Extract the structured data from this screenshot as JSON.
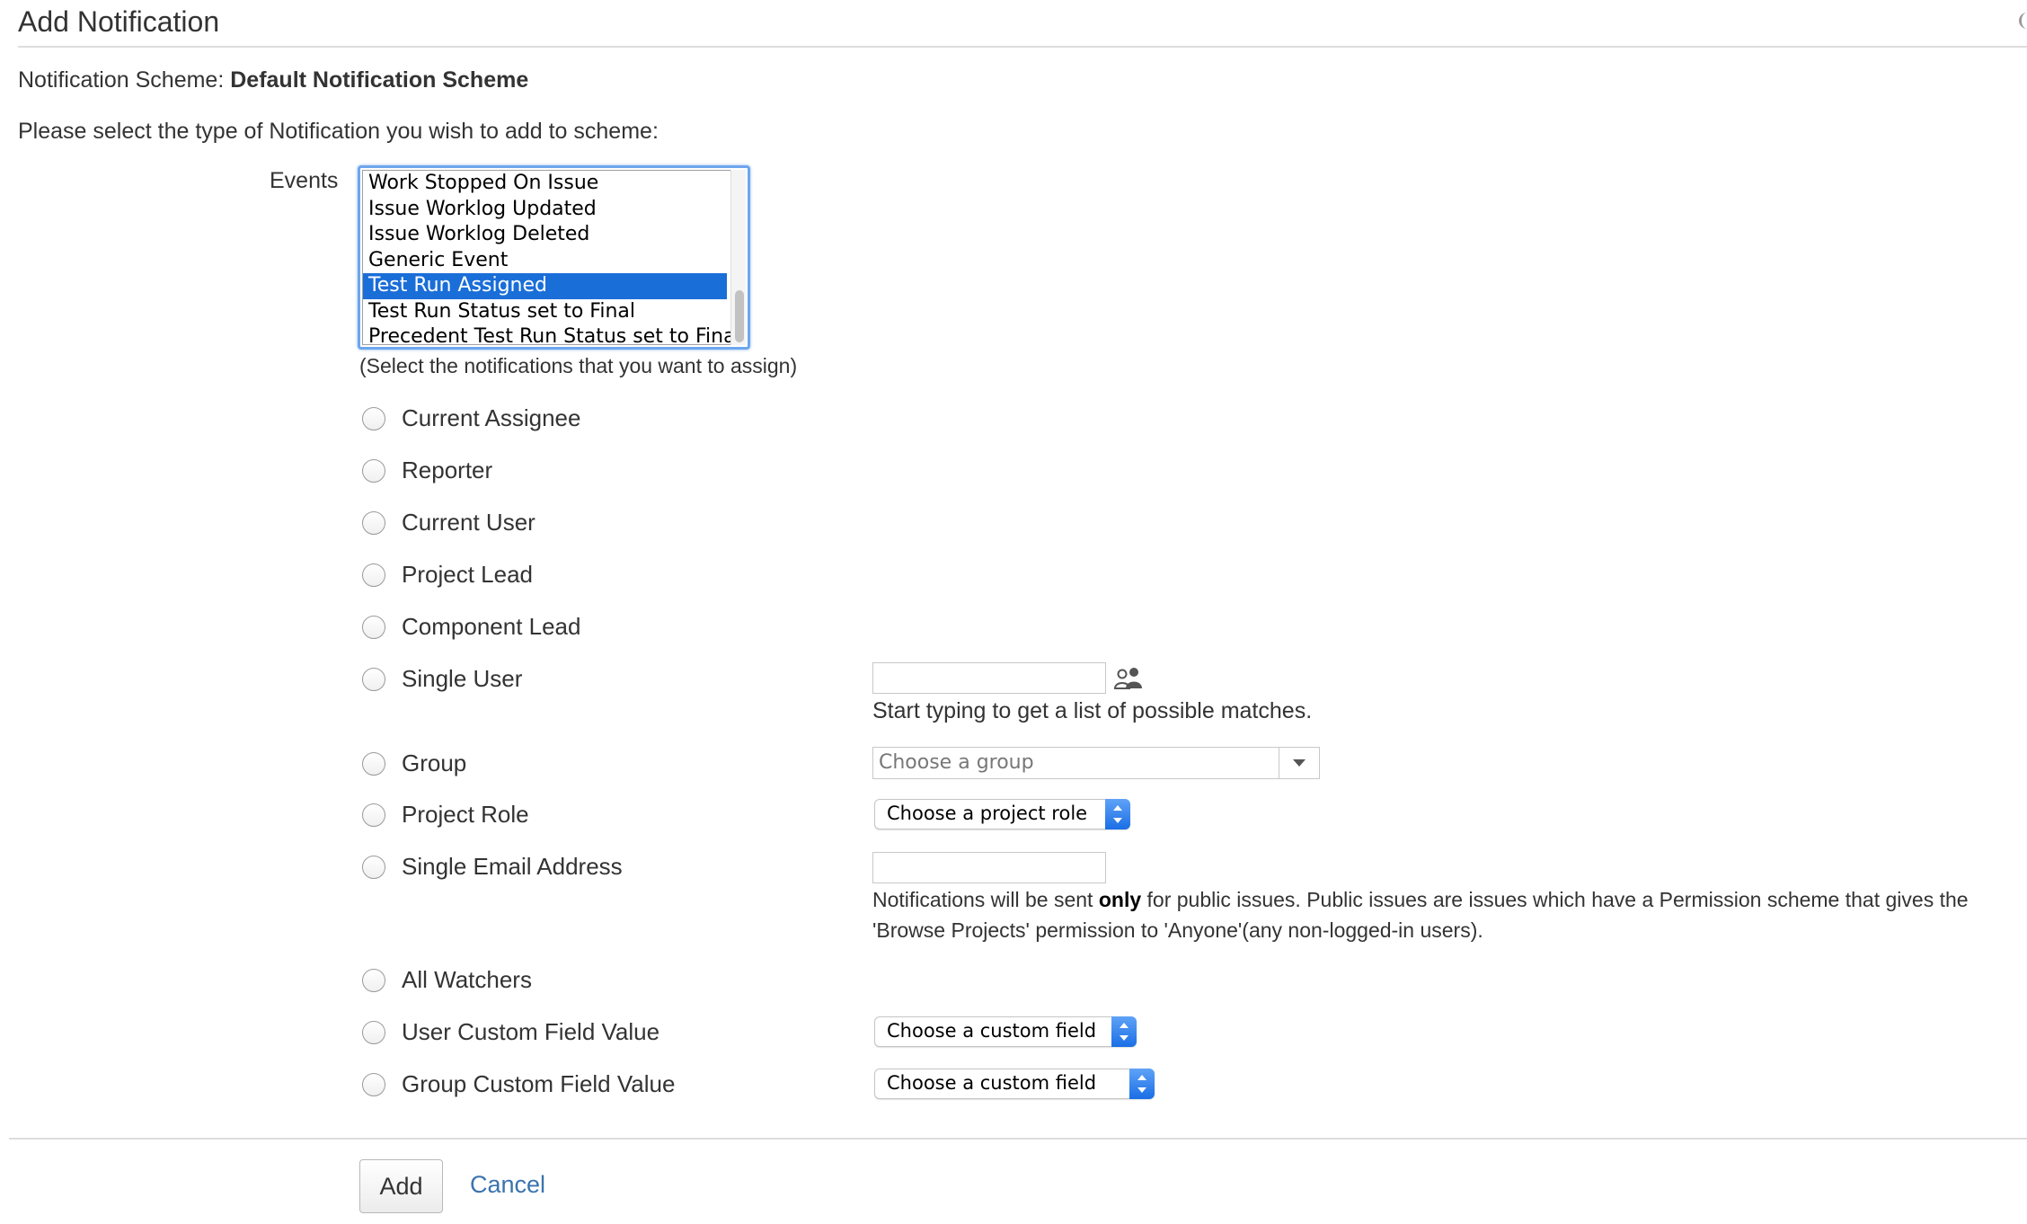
{
  "page": {
    "title": "Add Notification",
    "scheme_label": "Notification Scheme:",
    "scheme_name": "Default Notification Scheme",
    "prompt": "Please select the type of Notification you wish to add to scheme:"
  },
  "events": {
    "label": "Events",
    "items": [
      {
        "label": "Work Stopped On Issue",
        "selected": false
      },
      {
        "label": "Issue Worklog Updated",
        "selected": false
      },
      {
        "label": "Issue Worklog Deleted",
        "selected": false
      },
      {
        "label": "Generic Event",
        "selected": false
      },
      {
        "label": "Test Run Assigned",
        "selected": true
      },
      {
        "label": "Test Run Status set to Final",
        "selected": false
      },
      {
        "label": "Precedent Test Run Status set to Final",
        "selected": false
      }
    ],
    "hint": "(Select the notifications that you want to assign)"
  },
  "options": [
    {
      "label": "Current Assignee"
    },
    {
      "label": "Reporter"
    },
    {
      "label": "Current User"
    },
    {
      "label": "Project Lead"
    },
    {
      "label": "Component Lead"
    },
    {
      "label": "Single User"
    },
    {
      "label": "Group"
    },
    {
      "label": "Project Role"
    },
    {
      "label": "Single Email Address"
    },
    {
      "label": "All Watchers"
    },
    {
      "label": "User Custom Field Value"
    },
    {
      "label": "Group Custom Field Value"
    }
  ],
  "single_user": {
    "input_value": "",
    "picker_icon": "user-picker-icon",
    "help": "Start typing to get a list of possible matches."
  },
  "group": {
    "placeholder": "Choose a group"
  },
  "project_role": {
    "selected": "Choose a project role"
  },
  "email": {
    "input_value": "",
    "note_prefix": "Notifications will be sent ",
    "note_bold": "only",
    "note_suffix": " for public issues. Public issues are issues which have a Permission scheme that gives the 'Browse Projects' permission to 'Anyone'(any non-logged-in users)."
  },
  "user_custom_field": {
    "selected": "Choose a custom field"
  },
  "group_custom_field": {
    "selected": "Choose a custom field"
  },
  "actions": {
    "add_label": "Add",
    "cancel_label": "Cancel"
  },
  "colors": {
    "selection": "#1a6ed8",
    "link": "#3b73af",
    "focus_ring": "#6ea6ec"
  }
}
